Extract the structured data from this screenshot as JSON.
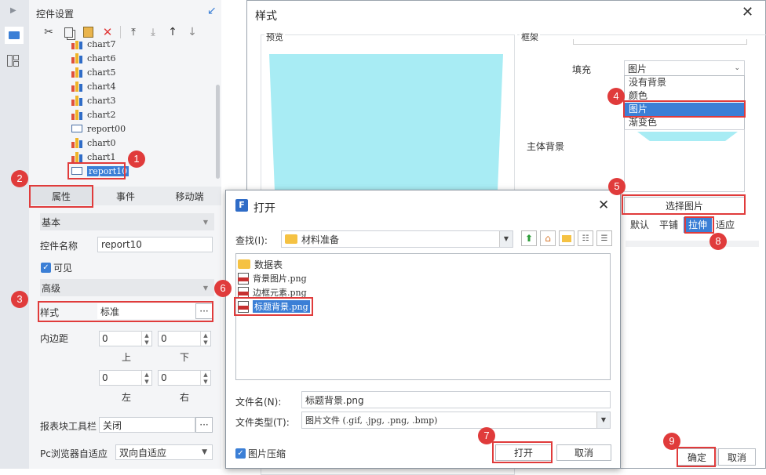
{
  "left_panel": {
    "title": "控件设置",
    "tree_items": [
      {
        "label": "chart7",
        "type": "chart"
      },
      {
        "label": "chart6",
        "type": "chart"
      },
      {
        "label": "chart5",
        "type": "chart"
      },
      {
        "label": "chart4",
        "type": "chart"
      },
      {
        "label": "chart3",
        "type": "chart"
      },
      {
        "label": "chart2",
        "type": "chart"
      },
      {
        "label": "report00",
        "type": "report"
      },
      {
        "label": "chart0",
        "type": "chart"
      },
      {
        "label": "chart1",
        "type": "chart"
      },
      {
        "label": "report10",
        "type": "report",
        "selected": true
      }
    ],
    "tabs": [
      {
        "label": "属性"
      },
      {
        "label": "事件"
      },
      {
        "label": "移动端"
      }
    ],
    "basic": {
      "header": "基本",
      "name_label": "控件名称",
      "name_value": "report10",
      "visible_label": "可见"
    },
    "advanced": {
      "header": "高级",
      "style_label": "样式",
      "style_value": "标准",
      "padding_label": "内边距",
      "pad_top": "0",
      "pad_bottom": "0",
      "pad_left": "0",
      "pad_right": "0",
      "top_label": "上",
      "bottom_label": "下",
      "left_label": "左",
      "right_label": "右",
      "toolbar_label": "报表块工具栏",
      "toolbar_value": "关闭",
      "browser_label": "Pc浏览器自适应",
      "browser_value": "双向自适应"
    }
  },
  "style_dialog": {
    "title": "样式",
    "preview_label": "预览",
    "frame_label": "框架",
    "fill_label": "填充",
    "fill_value": "图片",
    "fill_options": [
      "没有背景",
      "颜色",
      "图片",
      "渐变色"
    ],
    "main_bg_label": "主体背景",
    "choose_image_label": "选择图片",
    "image_modes": [
      "默认",
      "平铺",
      "拉伸",
      "适应"
    ],
    "selected_mode": "拉伸",
    "ok_label": "确定",
    "cancel_label": "取消"
  },
  "open_dialog": {
    "title": "打开",
    "lookin_label": "查找(I):",
    "lookin_value": "材料准备",
    "files": [
      {
        "name": "数据表",
        "type": "folder"
      },
      {
        "name": "背景图片.png",
        "type": "png"
      },
      {
        "name": "边框元素.png",
        "type": "png"
      },
      {
        "name": "标题背景.png",
        "type": "png",
        "selected": true
      }
    ],
    "filename_label": "文件名(N):",
    "filename_value": "标题背景.png",
    "filetype_label": "文件类型(T):",
    "filetype_value": "图片文件 (.gif, .jpg, .png, .bmp)",
    "compress_label": "图片压缩",
    "open_label": "打开",
    "cancel_label": "取消"
  },
  "badges": [
    "1",
    "2",
    "3",
    "4",
    "5",
    "6",
    "7",
    "8",
    "9"
  ],
  "colors": {
    "accent": "#3b7fd6",
    "highlight_red": "#e03b3b",
    "preview_fill": "#a8ecf4"
  }
}
